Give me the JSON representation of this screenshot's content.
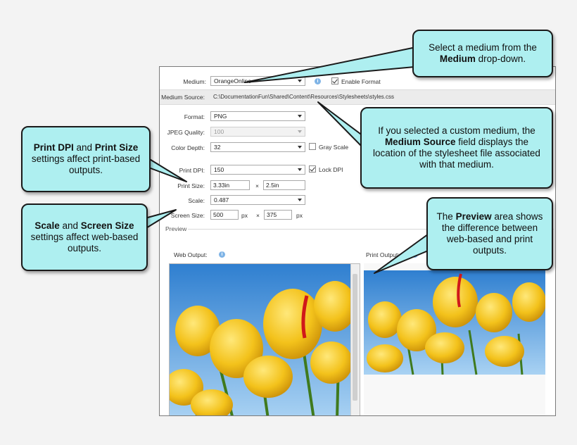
{
  "form": {
    "medium_label": "Medium:",
    "medium_value": "OrangeOnline",
    "enable_format_label": "Enable Format",
    "medium_source_label": "Medium Source:",
    "medium_source_value": "C:\\DocumentationFun\\Shared\\Content\\Resources\\Stylesheets\\styles.css",
    "format_label": "Format:",
    "format_value": "PNG",
    "jpeg_quality_label": "JPEG Quality:",
    "jpeg_quality_value": "100",
    "color_depth_label": "Color Depth:",
    "color_depth_value": "32",
    "gray_scale_label": "Gray Scale",
    "print_dpi_label": "Print DPI:",
    "print_dpi_value": "150",
    "lock_dpi_label": "Lock DPI",
    "print_size_label": "Print Size:",
    "print_size_w": "3.33in",
    "print_size_x": "×",
    "print_size_h": "2.5in",
    "scale_label": "Scale:",
    "scale_value": "0.487",
    "screen_size_label": "Screen Size:",
    "screen_size_w": "500",
    "screen_size_unit": "px",
    "screen_size_x": "×",
    "screen_size_h": "375",
    "screen_size_unit2": "px",
    "preview_label": "Preview",
    "web_output_label": "Web Output:",
    "print_output_label": "Print Output:"
  },
  "callouts": {
    "medium_a": "Select a medium from the",
    "medium_b": "Medium",
    "medium_c": "drop-down.",
    "source_a": "If you selected a custom medium, the",
    "source_b": "Medium Source",
    "source_c": "field displays the location of the stylesheet file associated with that medium.",
    "print_a": "Print DPI",
    "print_b": "and",
    "print_c": "Print Size",
    "print_d": "settings affect print-based outputs.",
    "scale_a": "Scale",
    "scale_b": "and",
    "scale_c": "Screen Size",
    "scale_d": "settings affect web-based outputs.",
    "preview_a": "The",
    "preview_b": "Preview",
    "preview_c": "area shows the difference between web-based and print outputs."
  },
  "colors": {
    "callout_fill": "#aeeff0",
    "sky": "#5aa7e0",
    "tulip": "#f2c21a"
  }
}
